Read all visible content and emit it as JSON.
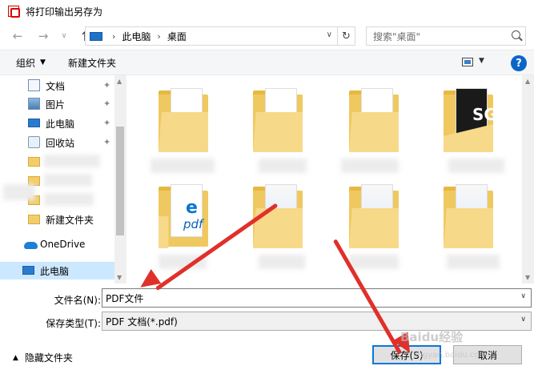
{
  "window": {
    "title": "将打印输出另存为"
  },
  "nav": {
    "breadcrumb": [
      "此电脑",
      "桌面"
    ],
    "search_placeholder": "搜索\"桌面\""
  },
  "toolbar": {
    "organize_label": "组织",
    "new_folder_label": "新建文件夹"
  },
  "sidebar": {
    "items": [
      {
        "label": "文档",
        "icon": "document-icon",
        "pinned": true
      },
      {
        "label": "图片",
        "icon": "picture-icon",
        "pinned": true
      },
      {
        "label": "此电脑",
        "icon": "computer-icon",
        "pinned": true
      },
      {
        "label": "回收站",
        "icon": "recycle-bin-icon",
        "pinned": true
      },
      {
        "label": "新建文件夹",
        "icon": "folder-icon",
        "pinned": false
      },
      {
        "label": "OneDrive",
        "icon": "onedrive-cloud-icon",
        "pinned": false
      },
      {
        "label": "此电脑",
        "icon": "computer-icon",
        "pinned": false,
        "selected": true
      }
    ]
  },
  "form": {
    "filename_label": "文件名(N):",
    "filename_value": "PDF文件",
    "filetype_label": "保存类型(T):",
    "filetype_value": "PDF 文档(*.pdf)"
  },
  "footer": {
    "hide_folders_label": "隐藏文件夹",
    "save_label": "保存(S)",
    "cancel_label": "取消"
  },
  "watermark": {
    "text": "Baidu经验",
    "sub": "jingyan.baidu.com"
  },
  "colors": {
    "accent": "#0a78d7",
    "selection": "#cce8ff",
    "annotation_arrow": "#e0302a",
    "folder": "#f0c860"
  }
}
